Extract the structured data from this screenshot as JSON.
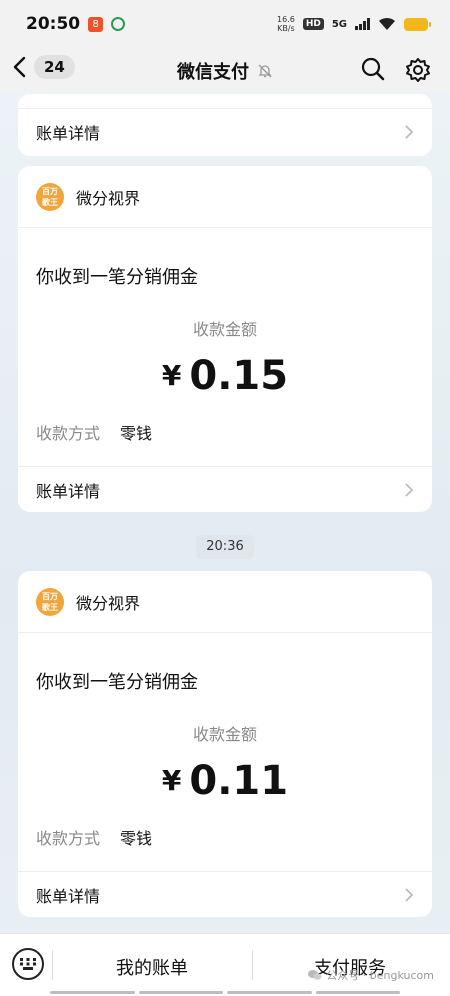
{
  "status_bar": {
    "time": "20:50",
    "net_speed": "16.6",
    "net_unit": "KB/s",
    "hd": "HD",
    "network": "5G",
    "app_badge": "8"
  },
  "nav": {
    "back_count": "24",
    "title": "微信支付"
  },
  "cards": [
    {
      "detail_label": "账单详情"
    },
    {
      "logo_text_1": "百万",
      "logo_text_2": "歌王",
      "sender": "微分视界",
      "message": "你收到一笔分销佣金",
      "amount_label": "收款金额",
      "currency": "¥",
      "amount": "0.15",
      "method_label": "收款方式",
      "method_value": "零钱",
      "detail_label": "账单详情"
    },
    {
      "logo_text_1": "百万",
      "logo_text_2": "歌王",
      "sender": "微分视界",
      "message": "你收到一笔分销佣金",
      "amount_label": "收款金额",
      "currency": "¥",
      "amount": "0.11",
      "method_label": "收款方式",
      "method_value": "零钱",
      "detail_label": "账单详情"
    }
  ],
  "timestamp": "20:36",
  "bottom": {
    "tab1": "我的账单",
    "tab2": "支付服务",
    "watermark": "公众号 · bengkucom"
  },
  "icons": [
    "back-chevron-icon",
    "mute-bell-icon",
    "search-icon",
    "settings-gear-icon",
    "chevron-right-icon",
    "keyboard-icon",
    "wechat-icon"
  ],
  "colors": {
    "logo_orange": "#f2a53a",
    "battery": "#f0b81a",
    "muted_text": "#8a8a8a"
  }
}
